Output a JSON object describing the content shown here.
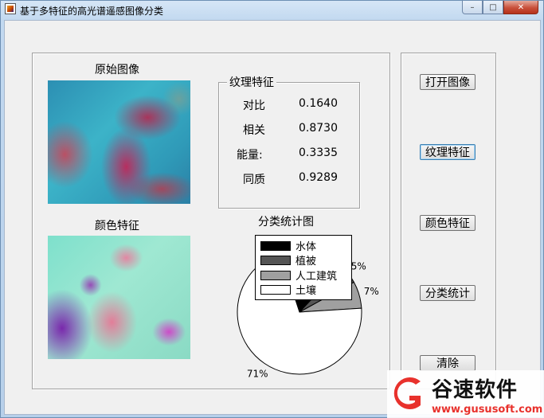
{
  "window": {
    "title": "基于多特征的高光谱遥感图像分类",
    "controls": {
      "minimize": "–",
      "maximize": "□",
      "close": "✕"
    }
  },
  "images": {
    "original_title": "原始图像",
    "color_title": "颜色特征"
  },
  "texture": {
    "group_title": "纹理特征",
    "rows": [
      {
        "label": "对比",
        "value": "0.1640"
      },
      {
        "label": "相关",
        "value": "0.8730"
      },
      {
        "label": "能量:",
        "value": "0.3335"
      },
      {
        "label": "同质",
        "value": "0.9289"
      }
    ]
  },
  "buttons": {
    "open_image": "打开图像",
    "texture_feature": "纹理特征",
    "color_feature": "颜色特征",
    "class_stats": "分类统计",
    "clear": "清除"
  },
  "chart_data": {
    "type": "pie",
    "title": "分类统计图",
    "series": [
      {
        "name": "水体",
        "value": 17,
        "label": "1",
        "color": "#000000"
      },
      {
        "name": "植被",
        "value": 5,
        "label": "5%",
        "color": "#555555"
      },
      {
        "name": "人工建筑",
        "value": 7,
        "label": "7%",
        "color": "#a0a0a0"
      },
      {
        "name": "土壤",
        "value": 71,
        "label": "71%",
        "color": "#ffffff"
      }
    ]
  },
  "watermark": {
    "brand": "谷速软件",
    "url": "www.gususoft.com",
    "logo_color": "#e8312c"
  }
}
